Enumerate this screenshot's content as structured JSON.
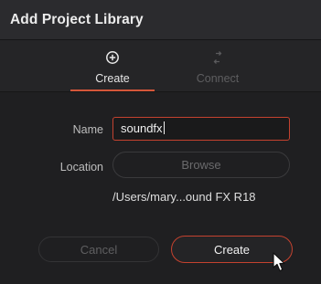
{
  "dialog": {
    "title": "Add Project Library"
  },
  "tabs": [
    {
      "label": "Create",
      "icon": "plus-circle-icon",
      "active": true
    },
    {
      "label": "Connect",
      "icon": "connect-arrows-icon",
      "active": false
    }
  ],
  "form": {
    "name_label": "Name",
    "name_value": "soundfx",
    "location_label": "Location",
    "browse_label": "Browse",
    "location_path": "/Users/mary...ound FX R18"
  },
  "buttons": {
    "cancel_label": "Cancel",
    "create_label": "Create"
  },
  "colors": {
    "accent": "#d4573a",
    "focus_border": "#c4422f",
    "background": "#1f1f21",
    "titlebar": "#2b2b2e"
  }
}
